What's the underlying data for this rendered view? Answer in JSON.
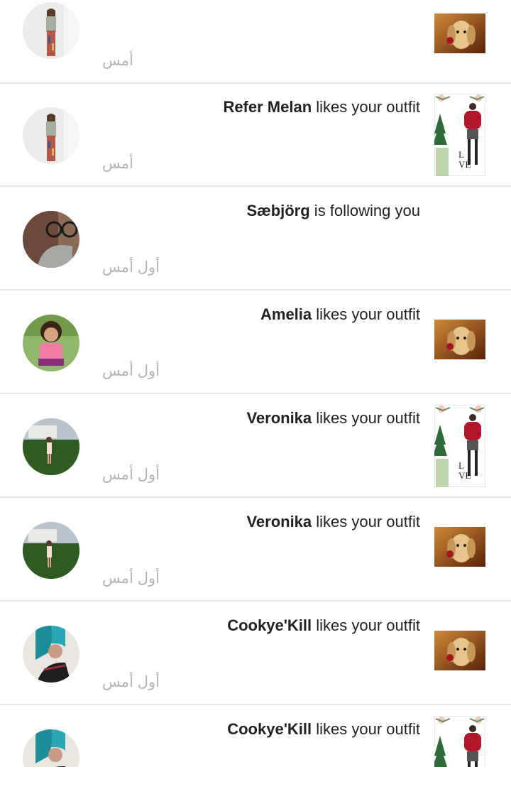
{
  "notifications": [
    {
      "user": "",
      "action": "",
      "time": "أمس",
      "avatar": "woman-standing-white",
      "thumb": "dog"
    },
    {
      "user": "Refer Melan",
      "action": " likes your outfit",
      "time": "أمس",
      "avatar": "woman-standing-white",
      "thumb": "outfit"
    },
    {
      "user": "Sæbjörg",
      "action": " is following you",
      "time": "أول أمس",
      "avatar": "glasses-person",
      "thumb": ""
    },
    {
      "user": "Amelia",
      "action": " likes your outfit",
      "time": "أول أمس",
      "avatar": "girl-pink-shirt",
      "thumb": "dog"
    },
    {
      "user": "Veronika",
      "action": " likes your outfit",
      "time": "أول أمس",
      "avatar": "woman-on-lawn",
      "thumb": "outfit"
    },
    {
      "user": "Veronika",
      "action": " likes your outfit",
      "time": "أول أمس",
      "avatar": "woman-on-lawn",
      "thumb": "dog"
    },
    {
      "user": "Cookye'Kill",
      "action": " likes your outfit",
      "time": "أول أمس",
      "avatar": "blue-hair-person",
      "thumb": "dog"
    },
    {
      "user": "Cookye'Kill",
      "action": " likes your outfit",
      "time": "",
      "avatar": "blue-hair-person",
      "thumb": "outfit"
    }
  ],
  "colors": {
    "divider": "#e6e6e6",
    "time_text": "#b3b3b3",
    "body_text": "#222222"
  }
}
